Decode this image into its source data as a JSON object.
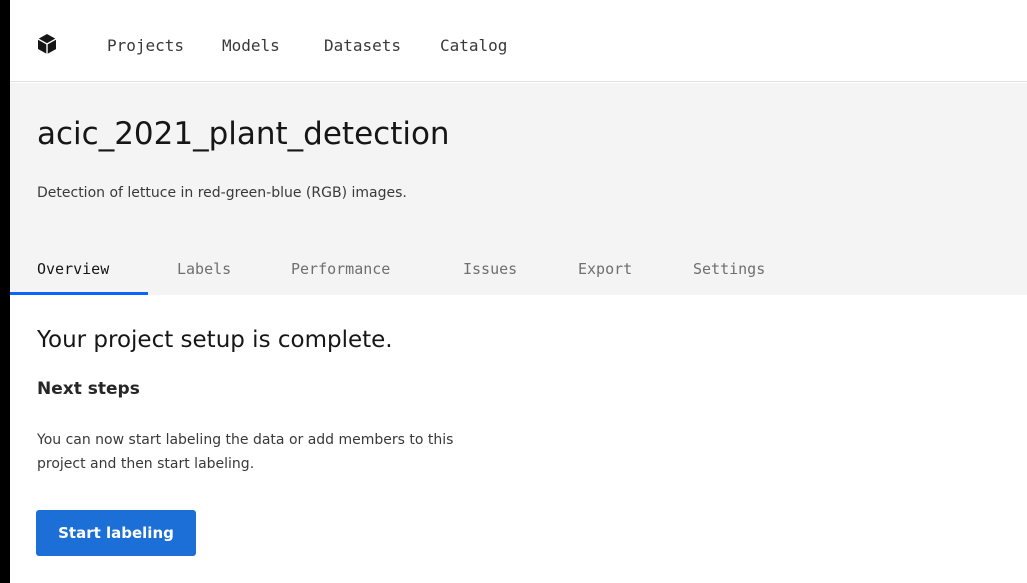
{
  "topnav": {
    "logo_icon": "cube-icon",
    "items": [
      {
        "label": "Projects"
      },
      {
        "label": "Models"
      },
      {
        "label": "Datasets"
      },
      {
        "label": "Catalog"
      }
    ]
  },
  "header": {
    "title": "acic_2021_plant_detection",
    "description": "Detection of lettuce in red-green-blue (RGB) images."
  },
  "tabs": [
    {
      "label": "Overview",
      "active": true
    },
    {
      "label": "Labels",
      "active": false
    },
    {
      "label": "Performance",
      "active": false
    },
    {
      "label": "Issues",
      "active": false
    },
    {
      "label": "Export",
      "active": false
    },
    {
      "label": "Settings",
      "active": false
    }
  ],
  "main": {
    "title": "Your project setup is complete.",
    "subtitle": "Next steps",
    "description": "You can now start labeling the data or add members to this project and then start labeling.",
    "start_button_label": "Start labeling"
  },
  "colors": {
    "accent": "#0f62fe",
    "button": "#1b6fd6",
    "header_bg": "#f4f4f4"
  }
}
